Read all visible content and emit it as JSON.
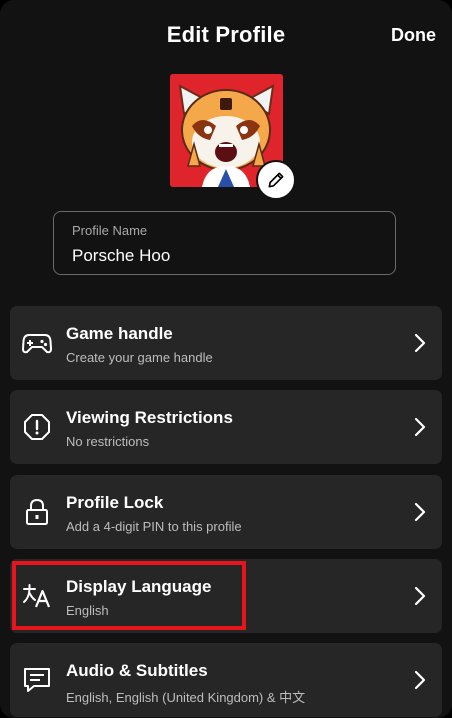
{
  "header": {
    "title": "Edit Profile",
    "done_label": "Done"
  },
  "avatar": {
    "icon": "red-panda-avatar",
    "edit_icon": "pencil-icon",
    "background_color": "#e0242b"
  },
  "profile_name": {
    "label": "Profile Name",
    "value": "Porsche Hoo"
  },
  "menu": {
    "items": [
      {
        "icon": "gamepad-icon",
        "title": "Game handle",
        "subtitle": "Create your game handle"
      },
      {
        "icon": "warning-hexagon-icon",
        "title": "Viewing Restrictions",
        "subtitle": "No restrictions"
      },
      {
        "icon": "lock-icon",
        "title": "Profile Lock",
        "subtitle": "Add a 4-digit PIN to this profile"
      },
      {
        "icon": "translate-icon",
        "title": "Display Language",
        "subtitle": "English"
      },
      {
        "icon": "subtitles-icon",
        "title": "Audio & Subtitles",
        "subtitle": "English, English (United Kingdom) & 中文"
      }
    ]
  },
  "highlight_color": "#e8141b",
  "colors": {
    "background": "#121212",
    "card": "#262626",
    "text": "#ffffff",
    "muted_text": "#bdbdbd"
  }
}
